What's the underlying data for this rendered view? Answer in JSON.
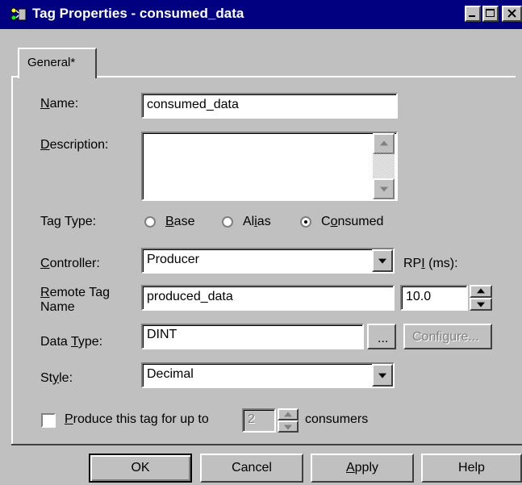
{
  "window": {
    "title": "Tag Properties - consumed_data"
  },
  "tabs": [
    {
      "label": "General*"
    }
  ],
  "form": {
    "name_label_key": "N",
    "name_label_rest": "ame:",
    "name_value": "consumed_data",
    "description_label_key": "D",
    "description_label_rest": "escription:",
    "description_value": "",
    "tag_type_label": "Tag Type:",
    "tag_type_options": [
      {
        "key": "B",
        "rest": "ase",
        "selected": false
      },
      {
        "pre": "Al",
        "key": "i",
        "rest": "as",
        "selected": false
      },
      {
        "pre": "C",
        "key": "o",
        "rest": "nsumed",
        "selected": true
      }
    ],
    "controller_label_key": "C",
    "controller_label_rest": "ontroller:",
    "controller_value": "Producer",
    "rpi_label_pre": "RP",
    "rpi_label_key": "I",
    "rpi_label_rest": " (ms):",
    "rpi_value": "10.0",
    "remote_tag_label_key": "R",
    "remote_tag_label_rest": "emote Tag",
    "remote_tag_label_line2": "Name",
    "remote_tag_value": "produced_data",
    "data_type_label_pre": "Data ",
    "data_type_label_key": "T",
    "data_type_label_rest": "ype:",
    "data_type_value": "DINT",
    "browse_label": "...",
    "configure_label": "Configure...",
    "style_label_pre": "St",
    "style_label_key": "y",
    "style_label_rest": "le:",
    "style_value": "Decimal",
    "produce_label_key": "P",
    "produce_label_rest": "roduce this tag for up to",
    "produce_count": "2",
    "consumers_label": "consumers",
    "produce_checked": false
  },
  "buttons": {
    "ok": "OK",
    "cancel": "Cancel",
    "apply_key": "A",
    "apply_rest": "pply",
    "help": "Help"
  }
}
